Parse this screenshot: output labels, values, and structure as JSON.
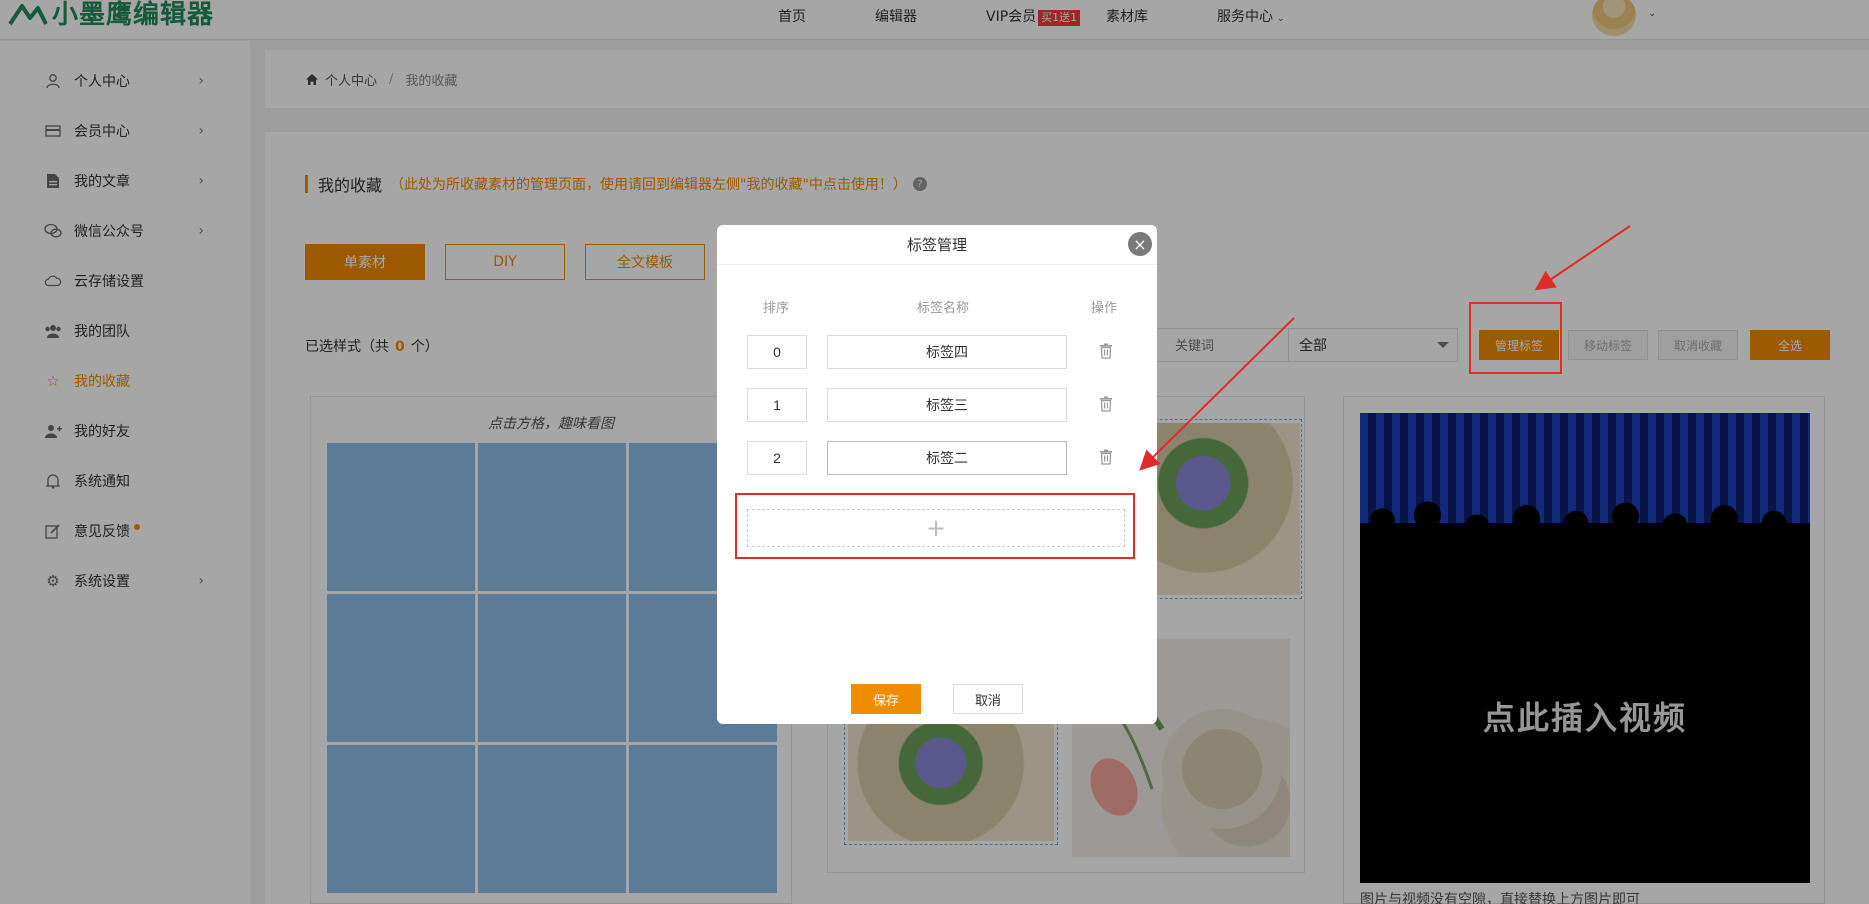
{
  "topnav": {
    "logo_text": "小墨鹰编辑器",
    "items": [
      "首页",
      "编辑器",
      "VIP会员",
      "素材库",
      "服务中心"
    ],
    "vip_badge": "买1送1"
  },
  "sidebar": {
    "items": [
      {
        "label": "个人中心",
        "icon": "user-icon"
      },
      {
        "label": "会员中心",
        "icon": "card-icon"
      },
      {
        "label": "我的文章",
        "icon": "document-icon"
      },
      {
        "label": "微信公众号",
        "icon": "wechat-icon"
      },
      {
        "label": "云存储设置",
        "icon": "cloud-icon"
      },
      {
        "label": "我的团队",
        "icon": "team-icon"
      },
      {
        "label": "我的收藏",
        "icon": "star-icon"
      },
      {
        "label": "我的好友",
        "icon": "add-friend-icon"
      },
      {
        "label": "系统通知",
        "icon": "bell-icon"
      },
      {
        "label": "意见反馈",
        "icon": "edit-icon"
      },
      {
        "label": "系统设置",
        "icon": "gear-icon"
      }
    ]
  },
  "breadcrumb": {
    "home": "个人中心",
    "current": "我的收藏"
  },
  "main": {
    "title": "我的收藏",
    "note": "（此处为所收藏素材的管理页面，使用请回到编辑器左侧\"我的收藏\"中点击使用！）",
    "tabs": [
      "单素材",
      "DIY",
      "全文模板"
    ],
    "selected_prefix": "已选样式（共",
    "selected_count": "0",
    "selected_suffix": "个）",
    "search_placeholder": "关键词",
    "filter_value": "全部",
    "actions": [
      "管理标签",
      "移动标签",
      "取消收藏",
      "全选"
    ],
    "card1_title": "点击方格，趣味看图",
    "video_text": "点此插入视频",
    "video_caption": "图片与视频没有空隙，直接替换上方图片即可"
  },
  "modal": {
    "title": "标签管理",
    "columns": [
      "排序",
      "标签名称",
      "操作"
    ],
    "rows": [
      {
        "order": "0",
        "name": "标签四"
      },
      {
        "order": "1",
        "name": "标签三"
      },
      {
        "order": "2",
        "name": "标签二"
      }
    ],
    "add_symbol": "+",
    "save": "保存",
    "cancel": "取消"
  },
  "colors": {
    "accent": "#f08c00",
    "annotation": "#e02b2b",
    "brand": "#1f8a5b"
  }
}
